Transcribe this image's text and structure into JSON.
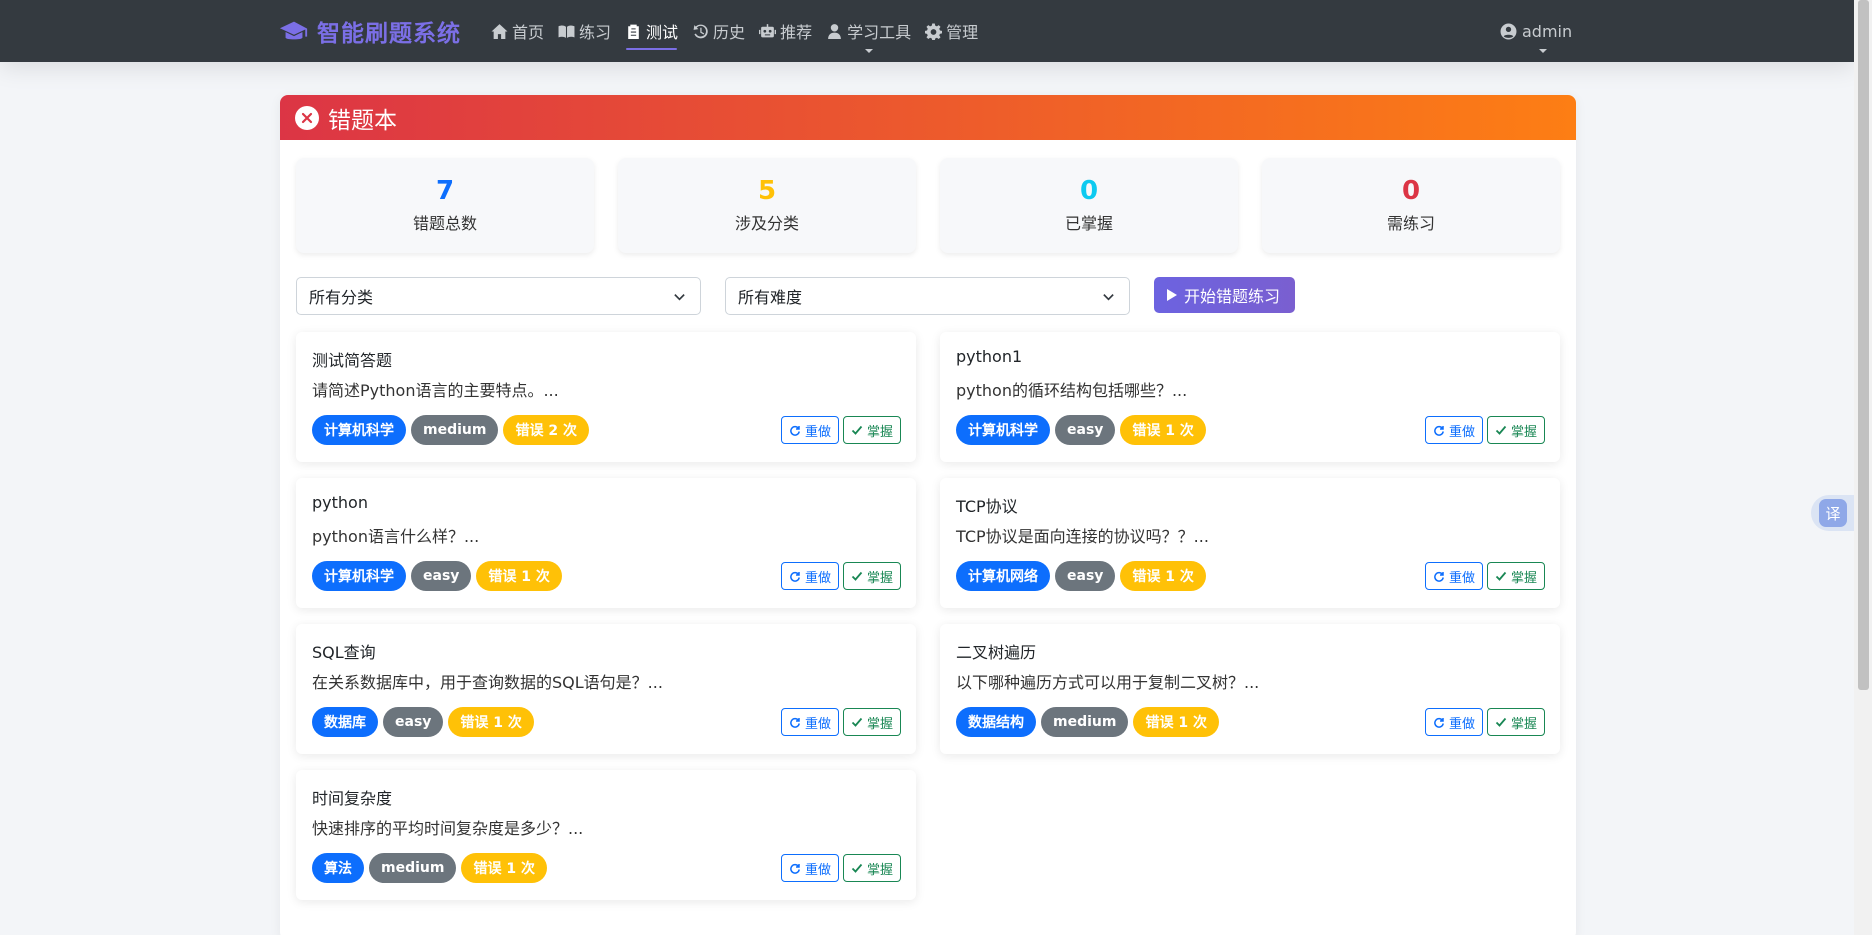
{
  "navbar": {
    "brand": "智能刷题系统",
    "items": [
      {
        "label": "首页",
        "icon": "home-icon"
      },
      {
        "label": "练习",
        "icon": "book-icon"
      },
      {
        "label": "测试",
        "icon": "clipboard-icon",
        "active": true
      },
      {
        "label": "历史",
        "icon": "history-icon"
      },
      {
        "label": "推荐",
        "icon": "robot-icon"
      },
      {
        "label": "学习工具",
        "icon": "user-icon",
        "dropdown": true
      },
      {
        "label": "管理",
        "icon": "gear-icon"
      }
    ],
    "user": "admin"
  },
  "page": {
    "title": "错题本",
    "stats": [
      {
        "value": "7",
        "label": "错题总数",
        "color": "#0d6efd"
      },
      {
        "value": "5",
        "label": "涉及分类",
        "color": "#ffc107"
      },
      {
        "value": "0",
        "label": "已掌握",
        "color": "#0dcaf0"
      },
      {
        "value": "0",
        "label": "需练习",
        "color": "#dc3545"
      }
    ],
    "filters": {
      "category": "所有分类",
      "difficulty": "所有难度",
      "start_button": "开始错题练习"
    },
    "questions": [
      {
        "title": "测试简答题",
        "desc": "请简述Python语言的主要特点。...",
        "category": "计算机科学",
        "difficulty": "medium",
        "errors": "错误 2 次"
      },
      {
        "title": "python1",
        "desc": "python的循环结构包括哪些？...",
        "category": "计算机科学",
        "difficulty": "easy",
        "errors": "错误 1 次"
      },
      {
        "title": "python",
        "desc": "python语言什么样？...",
        "category": "计算机科学",
        "difficulty": "easy",
        "errors": "错误 1 次"
      },
      {
        "title": "TCP协议",
        "desc": "TCP协议是面向连接的协议吗？？...",
        "category": "计算机网络",
        "difficulty": "easy",
        "errors": "错误 1 次"
      },
      {
        "title": "SQL查询",
        "desc": "在关系数据库中，用于查询数据的SQL语句是？...",
        "category": "数据库",
        "difficulty": "easy",
        "errors": "错误 1 次"
      },
      {
        "title": "二叉树遍历",
        "desc": "以下哪种遍历方式可以用于复制二叉树？...",
        "category": "数据结构",
        "difficulty": "medium",
        "errors": "错误 1 次"
      },
      {
        "title": "时间复杂度",
        "desc": "快速排序的平均时间复杂度是多少？...",
        "category": "算法",
        "difficulty": "medium",
        "errors": "错误 1 次"
      }
    ],
    "actions": {
      "redo": "重做",
      "master": "掌握"
    }
  },
  "translate": "译"
}
